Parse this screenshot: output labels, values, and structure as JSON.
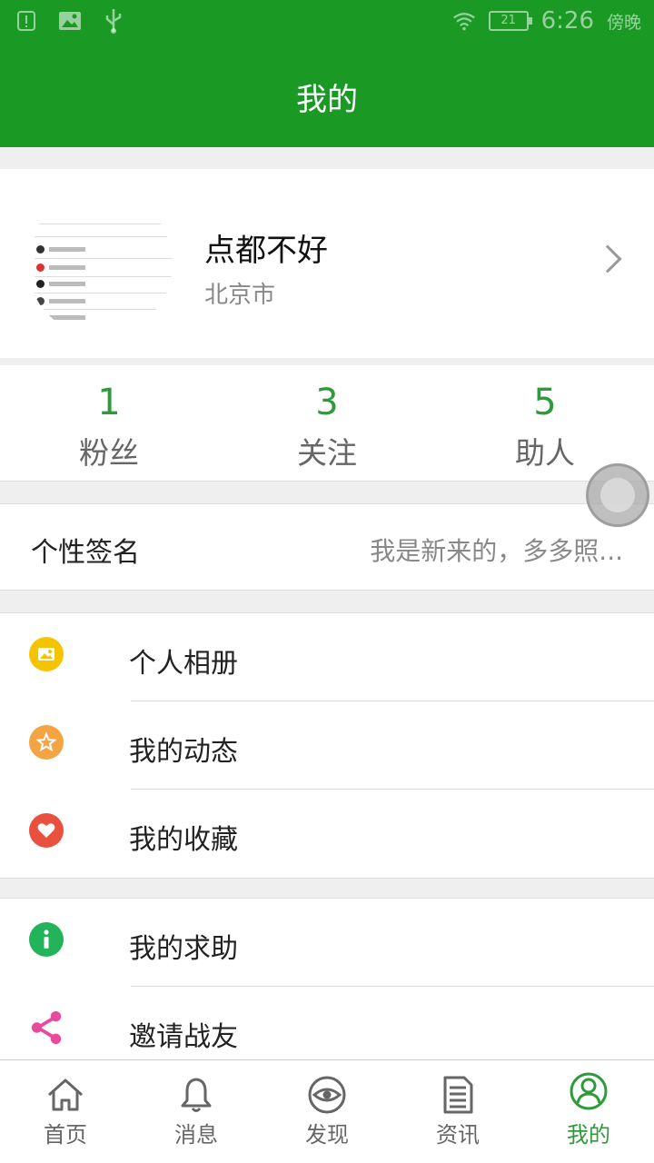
{
  "status_bar": {
    "time": "6:26",
    "period": "傍晚",
    "battery": "21",
    "left_icons": [
      "alert-icon",
      "image-icon",
      "usb-icon"
    ],
    "right_icons": [
      "wifi-icon",
      "battery-icon"
    ]
  },
  "header": {
    "title": "我的"
  },
  "profile": {
    "name": "点都不好",
    "city": "北京市",
    "avatar": "avatar-image",
    "chevron": "chevron-right-icon"
  },
  "stats": [
    {
      "value": "1",
      "label": "粉丝"
    },
    {
      "value": "3",
      "label": "关注"
    },
    {
      "value": "5",
      "label": "助人"
    }
  ],
  "signature": {
    "label": "个性签名",
    "value": "我是新来的，多多照..."
  },
  "menu_group_1": [
    {
      "label": "个人相册",
      "icon": "photo-icon",
      "color": "#f5c400"
    },
    {
      "label": "我的动态",
      "icon": "star-icon",
      "color": "#f5a443"
    },
    {
      "label": "我的收藏",
      "icon": "heart-icon",
      "color": "#e9503e"
    }
  ],
  "menu_group_2": [
    {
      "label": "我的求助",
      "icon": "info-icon",
      "color": "#23b35a"
    },
    {
      "label": "邀请战友",
      "icon": "share-icon",
      "color": "#e84a9c"
    }
  ],
  "bottom_nav": [
    {
      "label": "首页",
      "icon": "home-icon"
    },
    {
      "label": "消息",
      "icon": "bell-icon"
    },
    {
      "label": "发现",
      "icon": "eye-icon"
    },
    {
      "label": "资讯",
      "icon": "news-icon"
    },
    {
      "label": "我的",
      "icon": "user-icon"
    }
  ],
  "colors": {
    "primary": "#1a9a25",
    "accent_text": "#2e9b3b"
  }
}
